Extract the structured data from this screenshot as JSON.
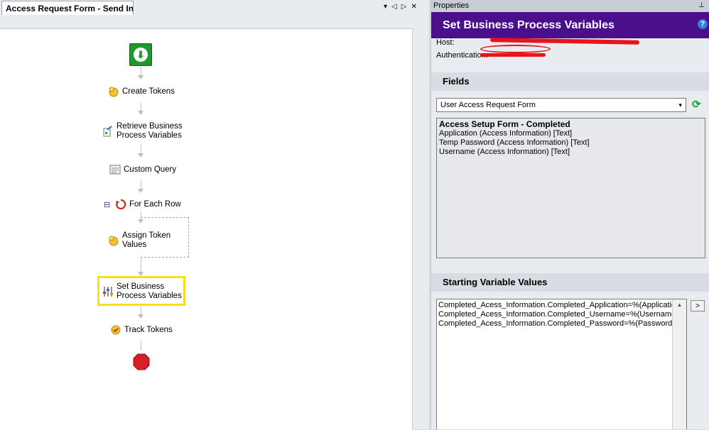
{
  "left_panel": {
    "tab_title": "Access Request Form - Send In...",
    "tab_controls": [
      "▾",
      "◁",
      "▷",
      "✕"
    ],
    "nodes": {
      "create_tokens": "Create Tokens",
      "retrieve_line1": "Retrieve Business",
      "retrieve_line2": "Process Variables",
      "custom_query": "Custom Query",
      "for_each_row": "For Each Row",
      "assign_line1": "Assign Token",
      "assign_line2": "Values",
      "set_line1": "Set Business",
      "set_line2": "Process Variables",
      "track_tokens": "Track Tokens"
    },
    "collapse_glyph": "⊟",
    "start_glyph": "⬇"
  },
  "properties": {
    "pane_title": "Properties",
    "pin_glyph": "⊥",
    "header": "Set Business Process Variables",
    "help_glyph": "?",
    "host_label": "Host:",
    "auth_label": "Authentication:",
    "fields_section": "Fields",
    "fields_dropdown": "User Access Request Form",
    "refresh_glyph": "⟳",
    "fields_group": "Access Setup Form - Completed",
    "fields_items": [
      "Application (Access Information) [Text]",
      "Temp Password (Access Information) [Text]",
      "Username (Access Information) [Text]"
    ],
    "starting_section": "Starting Variable Values",
    "variable_lines": [
      "Completed_Acess_Information.Completed_Application=%(Application)",
      "Completed_Acess_Information.Completed_Username=%(Username)",
      "Completed_Acess_Information.Completed_Password=%(Password)"
    ],
    "insert_label": ">",
    "scroll_up_glyph": "▲"
  },
  "colors": {
    "header_bg": "#4b0f8c",
    "selection_frame": "#f5e01a",
    "start_node": "#1f9a2f",
    "stop_node": "#d61f26"
  }
}
